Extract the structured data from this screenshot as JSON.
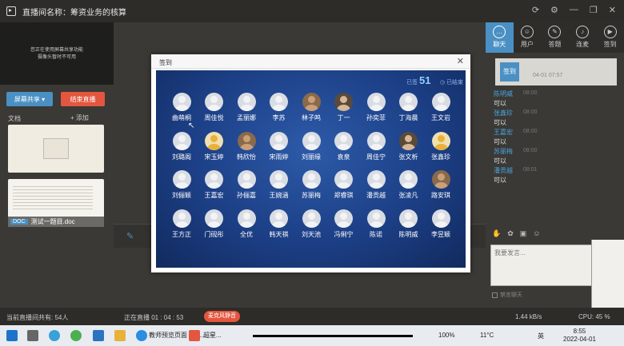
{
  "window": {
    "title": "直播间名称：筹资业务的核算"
  },
  "left": {
    "preview_text_1": "您正在使用屏幕共享功能",
    "preview_text_2": "摄像头暂时不可用",
    "share_button": "屏幕共享 ▾",
    "end_button": "结束直播",
    "docs_label": "文档",
    "add_doc": "+ 添加",
    "doc_tag": "DOC",
    "doc_name": "测试一题目.doc"
  },
  "right": {
    "tabs": [
      {
        "label": "聊天",
        "icon": "chat-icon"
      },
      {
        "label": "用户",
        "icon": "users-icon"
      },
      {
        "label": "答题",
        "icon": "edit-icon"
      },
      {
        "label": "连麦",
        "icon": "mic-icon"
      },
      {
        "label": "签到",
        "icon": "camera-icon"
      }
    ],
    "checkin_badge": "签到",
    "checkin_time": "04-01 07:57",
    "messages": [
      {
        "name": "陈明威",
        "time": "08:00",
        "text": "可以"
      },
      {
        "name": "张鑫珍",
        "time": "08:00",
        "text": "可以"
      },
      {
        "name": "王嘉宏",
        "time": "08:00",
        "text": "可以"
      },
      {
        "name": "苏丽梅",
        "time": "08:00",
        "text": "可以"
      },
      {
        "name": "潘贡越",
        "time": "08:01",
        "text": "可以"
      }
    ],
    "input_placeholder": "我要发言...",
    "forbid_label": "禁言聊天"
  },
  "status": {
    "online": "当前直播间共有: 54人",
    "live_time": "正在直播 01 : 04 : 53",
    "mute": "麦克风静音",
    "speed": "1.44 kB/s",
    "cpu": "CPU: 45 %"
  },
  "taskbar": {
    "browser_item": "教师预览页面 - 搜...",
    "app_item": "超星...",
    "battery": "100%",
    "weather": "11°C",
    "ime": "英",
    "time": "8:55",
    "date": "2022-04-01"
  },
  "modal": {
    "title": "签到",
    "count_label": "已签",
    "count": "51",
    "ended_label": "已结束",
    "people": [
      [
        "曲萌桐",
        "周佳悦",
        "孟丽娜",
        "李苏",
        "林子鸣",
        "丁一",
        "孙奕菲",
        "丁海晨",
        "王文岩"
      ],
      [
        "刘璐阁",
        "宋玉婷",
        "韩欣怡",
        "宋雨婷",
        "刘丽缘",
        "袁泉",
        "周佳宁",
        "张文析",
        "张鑫珍"
      ],
      [
        "刘俪颖",
        "王嘉宏",
        "孙俪嘉",
        "王婉涵",
        "苏丽梅",
        "郑睿琪",
        "潘贡越",
        "张凌凡",
        "路安琪"
      ],
      [
        "王方正",
        "门砚彤",
        "全优",
        "韩天祺",
        "刘天池",
        "冯俐宁",
        "陈诺",
        "陈明威",
        "李昱颖"
      ]
    ],
    "photo_avatars": [
      "林子鸣",
      "丁一",
      "宋玉婷",
      "韩欣怡",
      "张文析",
      "张鑫珍",
      "路安琪"
    ]
  }
}
